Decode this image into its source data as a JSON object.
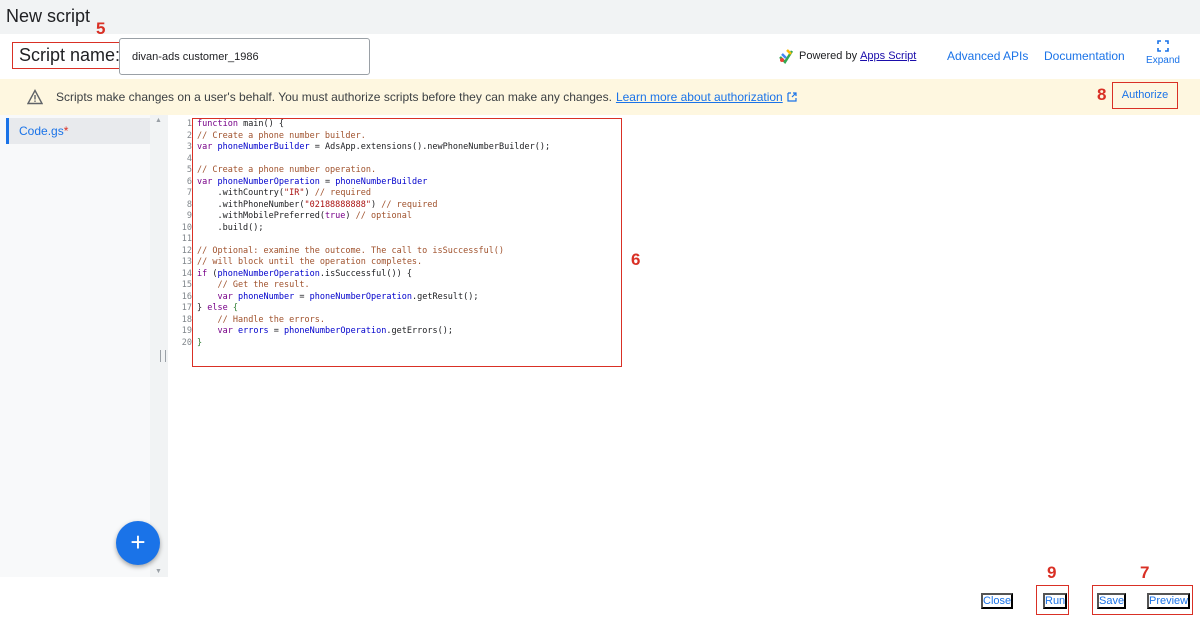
{
  "page": {
    "title": "New script"
  },
  "header": {
    "script_name_label": "Script name:",
    "script_name_value": "divan-ads customer_1986",
    "powered_by": "Powered by",
    "apps_script_link": "Apps Script",
    "advanced_apis": "Advanced APIs",
    "documentation": "Documentation",
    "expand": "Expand"
  },
  "banner": {
    "message": "Scripts make changes on a user's behalf. You must authorize scripts before they can make any changes.",
    "link": "Learn more about authorization",
    "authorize": "Authorize"
  },
  "files": {
    "active_file": "Code.gs",
    "dirty_marker": "*",
    "add_label": "+"
  },
  "editor": {
    "line_numbers": [
      "1",
      "2",
      "3",
      "4",
      "5",
      "6",
      "7",
      "8",
      "9",
      "10",
      "11",
      "12",
      "13",
      "14",
      "15",
      "16",
      "17",
      "18",
      "19",
      "20"
    ]
  },
  "annotations": {
    "script_name": "5",
    "code": "6",
    "save_preview": "7",
    "authorize": "8",
    "run": "9"
  },
  "footer": {
    "close": "Close",
    "run": "Run",
    "save": "Save",
    "preview": "Preview"
  },
  "colors": {
    "accent": "#1a73e8",
    "annotation": "#d93025",
    "banner_bg": "#fef7e0"
  }
}
